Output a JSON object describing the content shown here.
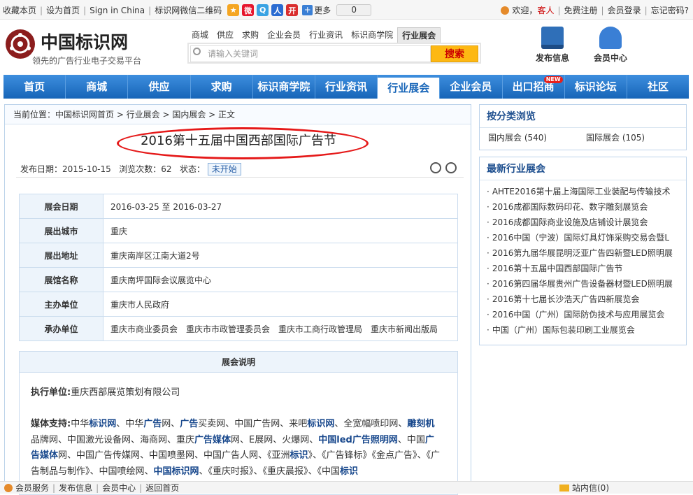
{
  "topbar": {
    "links": [
      "收藏本页",
      "设为首页",
      "Sign in China",
      "标识网微信二维码"
    ],
    "more": "更多",
    "count": "0",
    "welcome": "欢迎，",
    "guest": "客人",
    "register": "免费注册",
    "login": "会员登录",
    "forgot": "忘记密码?"
  },
  "header": {
    "logo_title": "中国标识网",
    "logo_sub": "领先的广告行业电子交易平台",
    "search_tabs": [
      "商城",
      "供应",
      "求购",
      "企业会员",
      "行业资讯",
      "标识商学院",
      "行业展会"
    ],
    "search_placeholder": "请输入关键词",
    "search_button": "搜索",
    "publish": "发布信息",
    "member_center": "会员中心"
  },
  "nav": [
    "首页",
    "商城",
    "供应",
    "求购",
    "标识商学院",
    "行业资讯",
    "行业展会",
    "企业会员",
    "出口招商",
    "标识论坛",
    "社区"
  ],
  "nav_new_badge": "NEW",
  "breadcrumb": "当前位置：中国标识网首页 > 行业展会 > 国内展会 > 正文",
  "article": {
    "title": "2016第十五届中国西部国际广告节",
    "publish_date": "发布日期：2015-10-15",
    "views": "浏览次数：62",
    "status_label": "状态：",
    "status": "未开始"
  },
  "info": [
    {
      "k": "展会日期",
      "v": "2016-03-25 至 2016-03-27"
    },
    {
      "k": "展出城市",
      "v": "重庆"
    },
    {
      "k": "展出地址",
      "v": "重庆南岸区江南大道2号"
    },
    {
      "k": "展馆名称",
      "v": "重庆南坪国际会议展览中心"
    },
    {
      "k": "主办单位",
      "v": "重庆市人民政府"
    },
    {
      "k": "承办单位",
      "v": "重庆市商业委员会　重庆市市政管理委员会　重庆市工商行政管理局　重庆市新闻出版局"
    }
  ],
  "desc": {
    "heading": "展会说明",
    "exec_label": "执行单位:",
    "exec_value": "重庆西部展览策划有限公司",
    "media_label": "媒体支持:"
  },
  "side": {
    "category_title": "按分类浏览",
    "categories": [
      "国内展会 (540)",
      "国际展会 (105)"
    ],
    "latest_title": "最新行业展会",
    "latest": [
      "AHTE2016第十届上海国际工业装配与传输技术",
      "2016成都国际数码印花、数字雕刻展览会",
      "2016成都国际商业设施及店铺设计展览会",
      "2016中国（宁波）国际灯具灯饰采购交易会暨L",
      "2016第九届华展昆明泛亚广告四新暨LED照明展",
      "2016第十五届中国西部国际广告节",
      "2016第四届华展贵州广告设备器材暨LED照明展",
      "2016第十七届长沙浩天广告四新展览会",
      "2016中国（广州）国际防伪技术与应用展览会",
      "中国（广州）国际包装印刷工业展览会"
    ]
  },
  "footer": {
    "links": [
      "会员服务",
      "发布信息",
      "会员中心",
      "返回首页"
    ],
    "inbox": "站内信(0)"
  }
}
